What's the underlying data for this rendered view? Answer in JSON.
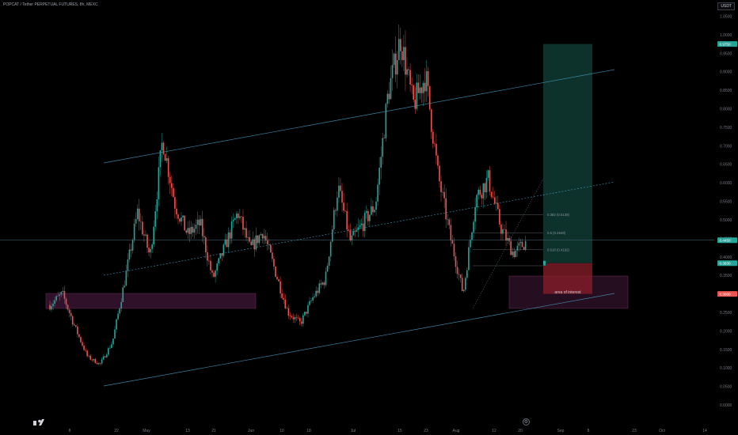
{
  "header": {
    "symbol_title": "POPCAT / Tether PERPETUAL FUTURES, 8h, MEXC",
    "currency_badge": "USDT"
  },
  "theme": {
    "background": "#000000",
    "up_color": "#26a69a",
    "down_color": "#ef5350",
    "channel_color": "#4aa3c8",
    "axis_text": "#787b86",
    "zone_fill": "#7b2d6b",
    "target_fill": "#0f3b33",
    "stop_fill": "#8b1e2a"
  },
  "icons": {
    "logo": "tradingview-logo-icon",
    "settings": "settings-gear-icon"
  },
  "chart_data": {
    "type": "candlestick",
    "y_axis": {
      "scale": "linear",
      "ticks": [
        "1.0500",
        "1.0000",
        "0.9500",
        "0.9000",
        "0.8500",
        "0.8000",
        "0.7500",
        "0.7000",
        "0.6500",
        "0.6000",
        "0.5500",
        "0.5000",
        "0.4500",
        "0.4000",
        "0.3500",
        "0.3000",
        "0.2500",
        "0.2000",
        "0.1500",
        "0.1000",
        "0.0500",
        "0.0000"
      ],
      "range": [
        0.0,
        1.06
      ]
    },
    "x_axis": {
      "ticks": [
        "8",
        "22",
        "May",
        "13",
        "21",
        "Jun",
        "10",
        "18",
        "Jul",
        "15",
        "23",
        "Aug",
        "12",
        "20",
        "Sep",
        "8",
        "23",
        "Oct",
        "14"
      ]
    },
    "price_badges": [
      {
        "role": "target",
        "value": 0.975,
        "color": "#26a69a"
      },
      {
        "role": "current",
        "value": 0.445,
        "color": "#26a69a"
      },
      {
        "role": "entry",
        "value": 0.383,
        "color": "#26a69a"
      },
      {
        "role": "stop",
        "value": 0.3,
        "color": "#ef5350"
      }
    ],
    "fib_levels": [
      {
        "label": "0.382 (0.5139)",
        "value": 0.5139
      },
      {
        "label": "0.5 (0.4648)",
        "value": 0.4648
      },
      {
        "label": "0.618 (0.4192)",
        "value": 0.4192
      }
    ],
    "annotations": [
      {
        "text": "area of interest"
      }
    ],
    "key_prices": [
      {
        "x": "Apr 1",
        "y": 0.27
      },
      {
        "x": "Apr 3",
        "y": 0.3
      },
      {
        "x": "Apr 7",
        "y": 0.21
      },
      {
        "x": "Apr 12",
        "y": 0.13
      },
      {
        "x": "Apr 15",
        "y": 0.11
      },
      {
        "x": "Apr 20",
        "y": 0.17
      },
      {
        "x": "Apr 23",
        "y": 0.34
      },
      {
        "x": "Apr 26",
        "y": 0.52
      },
      {
        "x": "Apr 29",
        "y": 0.4
      },
      {
        "x": "May 3",
        "y": 0.72
      },
      {
        "x": "May 8",
        "y": 0.54
      },
      {
        "x": "May 12",
        "y": 0.46
      },
      {
        "x": "May 18",
        "y": 0.49
      },
      {
        "x": "May 22",
        "y": 0.34
      },
      {
        "x": "May 26",
        "y": 0.43
      },
      {
        "x": "May 30",
        "y": 0.52
      },
      {
        "x": "Jun 3",
        "y": 0.42
      },
      {
        "x": "Jun 6",
        "y": 0.47
      },
      {
        "x": "Jun 10",
        "y": 0.36
      },
      {
        "x": "Jun 15",
        "y": 0.25
      },
      {
        "x": "Jun 20",
        "y": 0.22
      },
      {
        "x": "Jun 24",
        "y": 0.29
      },
      {
        "x": "Jun 28",
        "y": 0.34
      },
      {
        "x": "Jul 1",
        "y": 0.59
      },
      {
        "x": "Jul 4",
        "y": 0.44
      },
      {
        "x": "Jul 8",
        "y": 0.49
      },
      {
        "x": "Jul 11",
        "y": 0.54
      },
      {
        "x": "Jul 15",
        "y": 0.84
      },
      {
        "x": "Jul 19",
        "y": 0.99
      },
      {
        "x": "Jul 22",
        "y": 0.81
      },
      {
        "x": "Jul 25",
        "y": 0.89
      },
      {
        "x": "Jul 29",
        "y": 0.62
      },
      {
        "x": "Aug 2",
        "y": 0.45
      },
      {
        "x": "Aug 5",
        "y": 0.3
      },
      {
        "x": "Aug 8",
        "y": 0.56
      },
      {
        "x": "Aug 12",
        "y": 0.61
      },
      {
        "x": "Aug 16",
        "y": 0.48
      },
      {
        "x": "Aug 19",
        "y": 0.41
      },
      {
        "x": "Aug 22",
        "y": 0.44
      }
    ]
  }
}
